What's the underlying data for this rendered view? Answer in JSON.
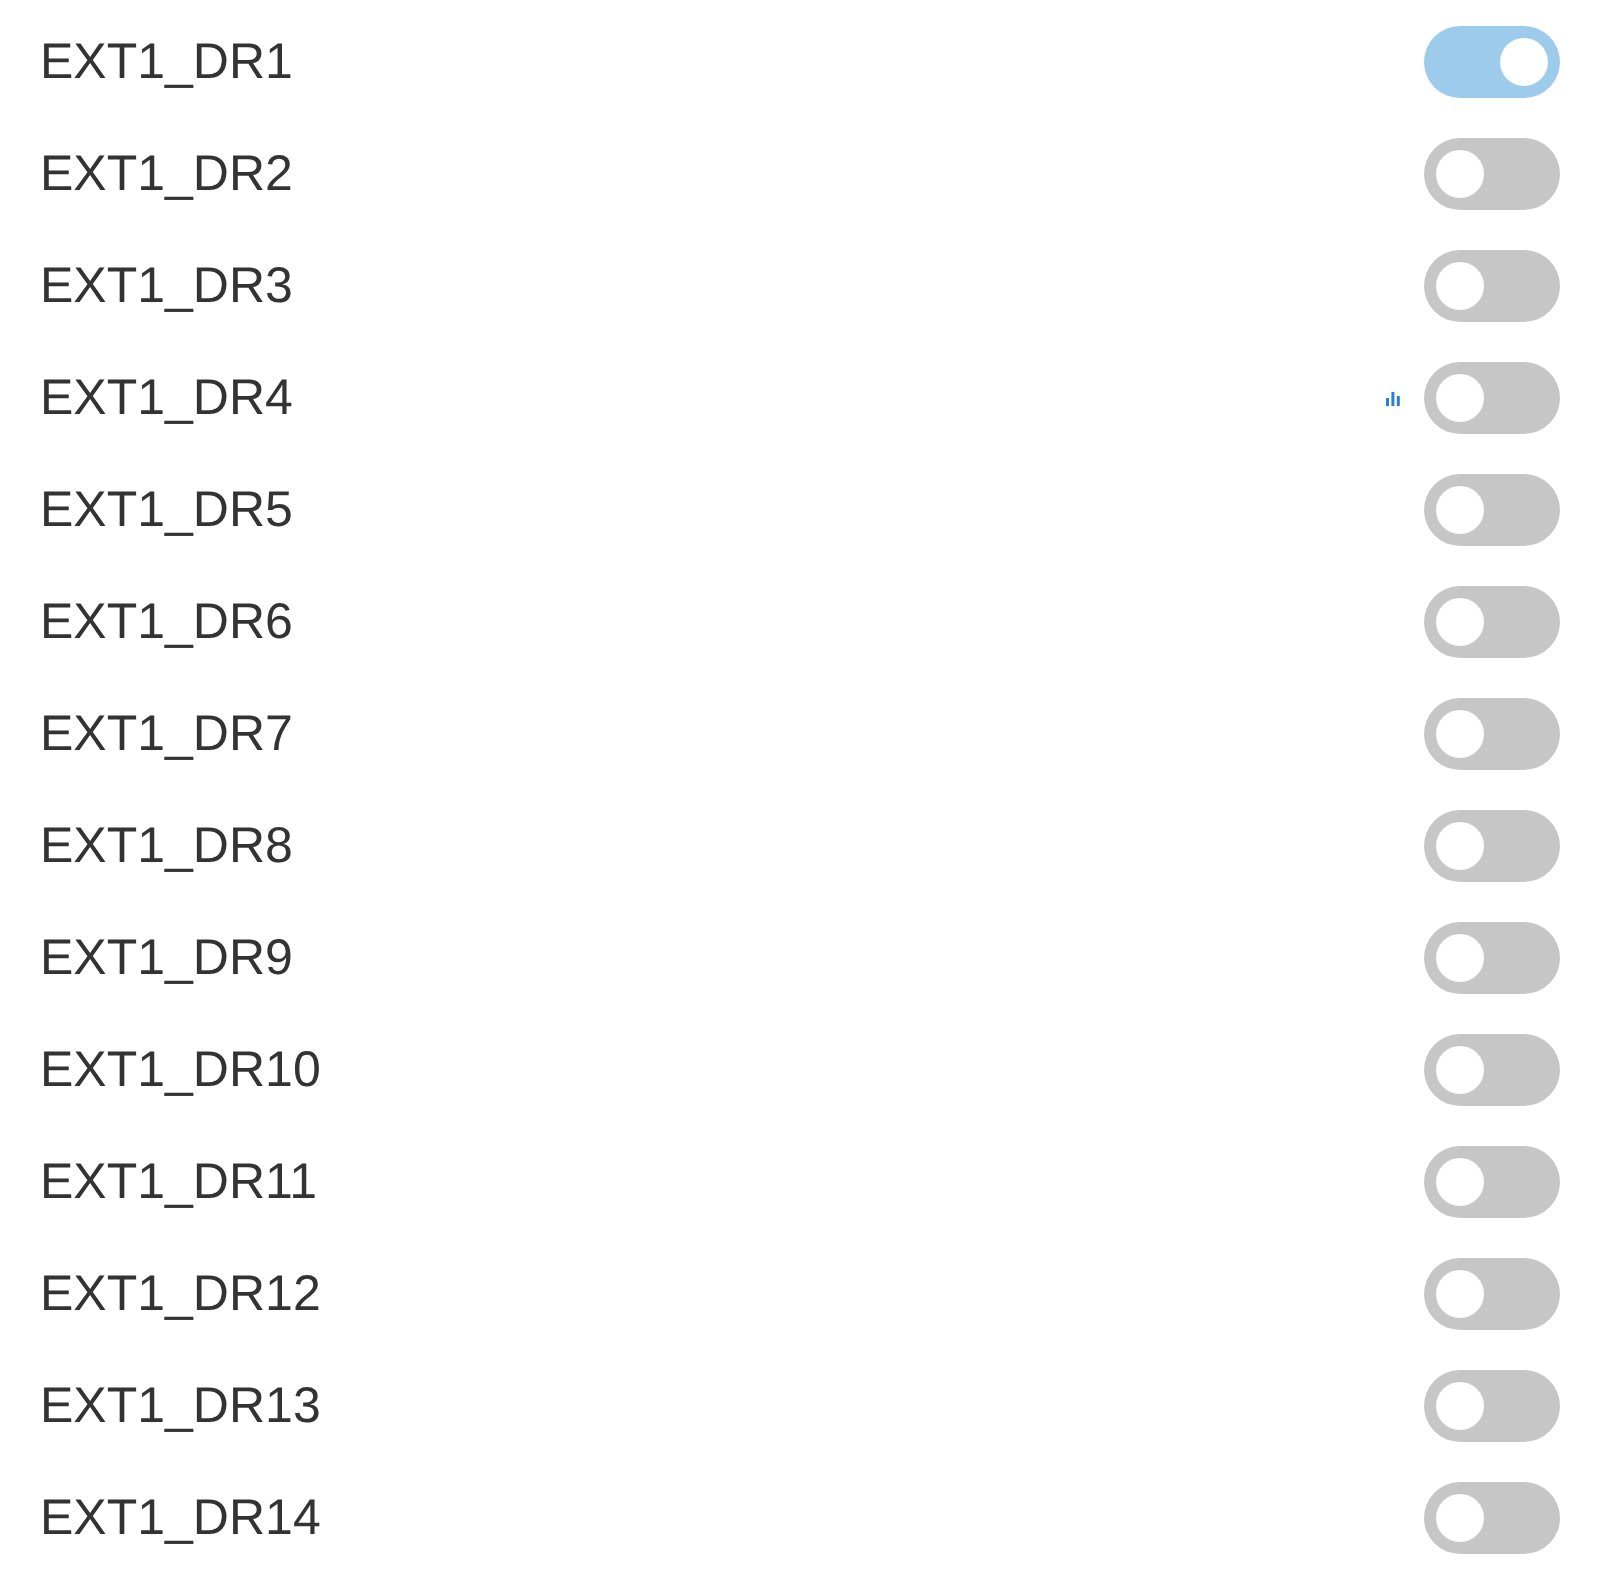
{
  "switches": [
    {
      "label": "EXT1_DR1",
      "on": true,
      "stats": false
    },
    {
      "label": "EXT1_DR2",
      "on": false,
      "stats": false
    },
    {
      "label": "EXT1_DR3",
      "on": false,
      "stats": false
    },
    {
      "label": "EXT1_DR4",
      "on": false,
      "stats": true
    },
    {
      "label": "EXT1_DR5",
      "on": false,
      "stats": false
    },
    {
      "label": "EXT1_DR6",
      "on": false,
      "stats": false
    },
    {
      "label": "EXT1_DR7",
      "on": false,
      "stats": false
    },
    {
      "label": "EXT1_DR8",
      "on": false,
      "stats": false
    },
    {
      "label": "EXT1_DR9",
      "on": false,
      "stats": false
    },
    {
      "label": "EXT1_DR10",
      "on": false,
      "stats": false
    },
    {
      "label": "EXT1_DR11",
      "on": false,
      "stats": false
    },
    {
      "label": "EXT1_DR12",
      "on": false,
      "stats": false
    },
    {
      "label": "EXT1_DR13",
      "on": false,
      "stats": false
    },
    {
      "label": "EXT1_DR14",
      "on": false,
      "stats": false
    }
  ]
}
